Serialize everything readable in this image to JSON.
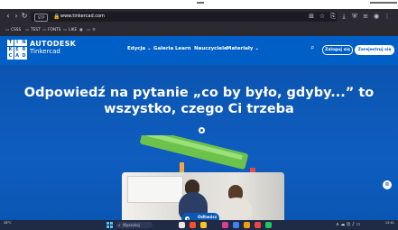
{
  "browser": {
    "badge": "STP",
    "url": "www.tinkercad.com",
    "bookmarks": [
      "CSSS",
      "TEST",
      "FONTS",
      "LIKE",
      "",
      ""
    ]
  },
  "site": {
    "brand_line1": "AUTODESK",
    "brand_line2": "Tinkercad",
    "logo_letters": [
      "T",
      "I",
      "N",
      "K",
      "E",
      "R",
      "C",
      "A",
      "D"
    ],
    "menu": [
      "Edycja ⌄",
      "Galeria",
      "Learn",
      "Nauczyciele",
      "Materiały ⌄"
    ],
    "login": "Zaloguj się",
    "signup": "Zarejestruj się"
  },
  "hero": {
    "title": "Odpowiedź na pytanie „co by było, gdyby...” to wszystko, czego Ci trzeba",
    "pause_label": "II"
  },
  "popup": {
    "label": "Odtwórz"
  },
  "taskbar": {
    "left_line1": "28°C",
    "left_line2": "",
    "search": "Wyszukaj",
    "tray_time": "12:41",
    "tray_date": "",
    "sys_icons": "∧ ☁ ⌬ ♪ ▭"
  },
  "colors": {
    "brand_blue": "#005fc7",
    "hero_blue": "#0a57b5"
  }
}
